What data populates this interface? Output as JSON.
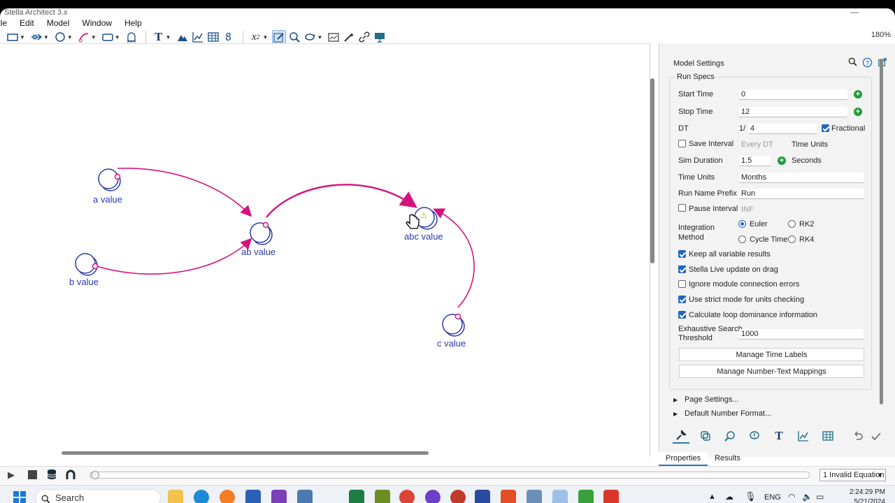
{
  "window": {
    "title": "Stella Architect 3.x",
    "zoom": "180%"
  },
  "menu": [
    "ile",
    "Edit",
    "Model",
    "Window",
    "Help"
  ],
  "canvas": {
    "variables": [
      {
        "name": "a value"
      },
      {
        "name": "b value"
      },
      {
        "name": "ab value"
      },
      {
        "name": "abc value"
      },
      {
        "name": "c value"
      }
    ],
    "warning_symbol": "⚠",
    "colors": {
      "connector": "#d4137f",
      "converter": "#2a3aa8"
    }
  },
  "panel": {
    "header": "Model Settings",
    "section": "Run Specs",
    "start_time": {
      "label": "Start Time",
      "value": "0"
    },
    "stop_time": {
      "label": "Stop Time",
      "value": "12"
    },
    "dt": {
      "label": "DT",
      "prefix": "1/",
      "value": "4",
      "fractional_label": "Fractional",
      "fractional": true
    },
    "save_interval": {
      "label": "Save Interval",
      "value": "Every DT",
      "units": "Time Units",
      "checked": false
    },
    "sim_duration": {
      "label": "Sim Duration",
      "value": "1.5",
      "units": "Seconds"
    },
    "time_units": {
      "label": "Time Units",
      "value": "Months"
    },
    "run_name_prefix": {
      "label": "Run Name Prefix",
      "value": "Run"
    },
    "pause_interval": {
      "label": "Pause Interval",
      "value": "INF",
      "checked": false
    },
    "integration": {
      "label_line1": "Integration",
      "label_line2": "Method",
      "options": [
        "Euler",
        "RK2",
        "Cycle Time",
        "RK4"
      ],
      "selected": "Euler"
    },
    "checkboxes": [
      {
        "label": "Keep all variable results",
        "checked": true
      },
      {
        "label": "Stella Live update on drag",
        "checked": true
      },
      {
        "label": "Ignore module connection errors",
        "checked": false
      },
      {
        "label": "Use strict mode for units checking",
        "checked": true
      },
      {
        "label": "Calculate loop dominance information",
        "checked": true
      }
    ],
    "exhaustive": {
      "label_line1": "Exhaustive Search",
      "label_line2": "Threshold",
      "value": "1000"
    },
    "buttons": {
      "time_labels": "Manage Time Labels",
      "number_text": "Manage Number-Text Mappings"
    },
    "collapsed": [
      "Page Settings...",
      "Default Number Format..."
    ],
    "tabs": [
      "Properties",
      "Results"
    ],
    "active_tab": "Properties"
  },
  "runbar": {
    "status": "1 Invalid Equation"
  },
  "taskbar": {
    "search_placeholder": "Search",
    "lang": "ENG",
    "time": "2:24:29 PM",
    "date": "5/21/2024"
  }
}
